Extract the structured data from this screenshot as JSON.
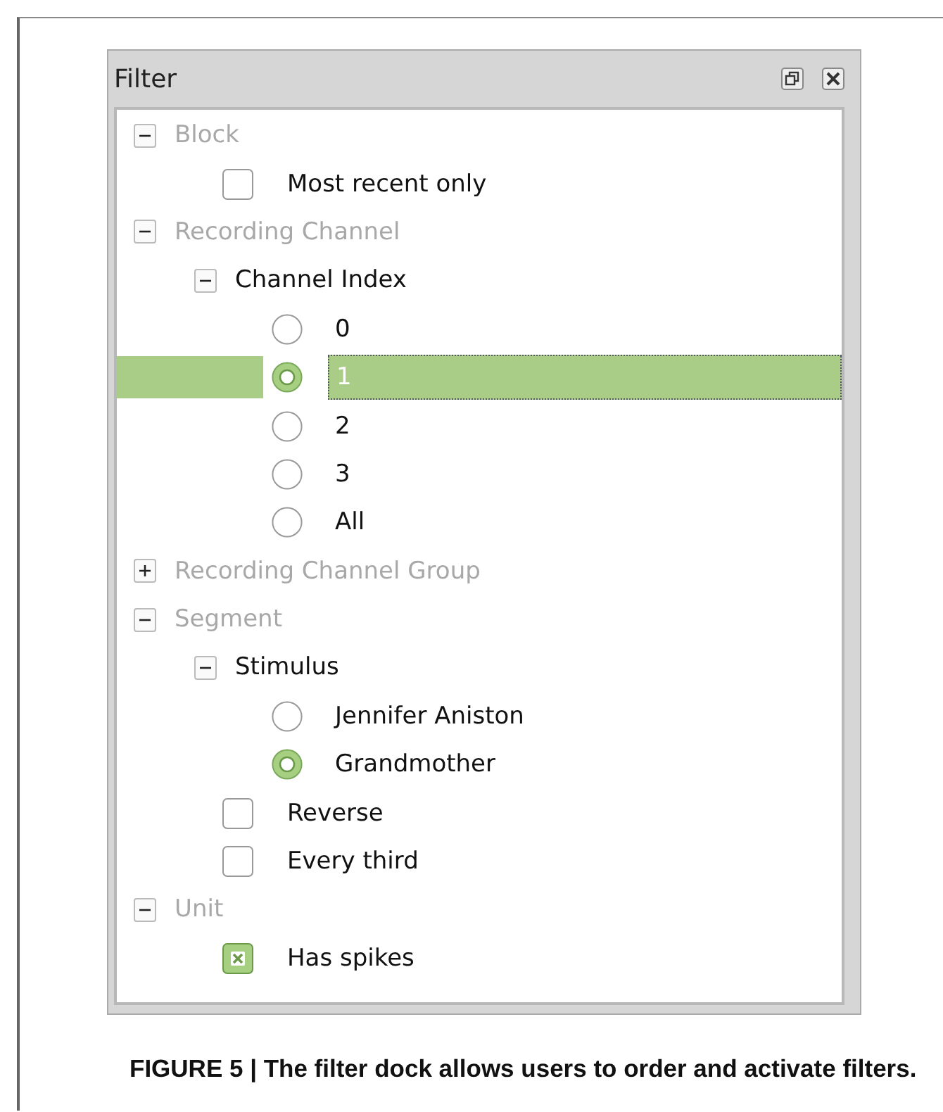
{
  "dock": {
    "title": "Filter"
  },
  "tree": [
    {
      "kind": "group",
      "label": "Block",
      "expanded": true,
      "children": [
        {
          "kind": "checkbox",
          "label": "Most recent only",
          "checked": false
        }
      ]
    },
    {
      "kind": "group",
      "label": "Recording Channel",
      "expanded": true,
      "children": [
        {
          "kind": "subgroup",
          "label": "Channel Index",
          "expanded": true,
          "children": [
            {
              "kind": "radio",
              "label": "0",
              "selected": false
            },
            {
              "kind": "radio",
              "label": "1",
              "selected": true,
              "current": true
            },
            {
              "kind": "radio",
              "label": "2",
              "selected": false
            },
            {
              "kind": "radio",
              "label": "3",
              "selected": false
            },
            {
              "kind": "radio",
              "label": "All",
              "selected": false
            }
          ]
        }
      ]
    },
    {
      "kind": "group",
      "label": "Recording Channel Group",
      "expanded": false
    },
    {
      "kind": "group",
      "label": "Segment",
      "expanded": true,
      "children": [
        {
          "kind": "subgroup",
          "label": "Stimulus",
          "expanded": true,
          "children": [
            {
              "kind": "radio",
              "label": "Jennifer Aniston",
              "selected": false
            },
            {
              "kind": "radio",
              "label": "Grandmother",
              "selected": true
            }
          ]
        },
        {
          "kind": "checkbox",
          "label": "Reverse",
          "checked": false
        },
        {
          "kind": "checkbox",
          "label": "Every third",
          "checked": false
        }
      ]
    },
    {
      "kind": "group",
      "label": "Unit",
      "expanded": true,
      "children": [
        {
          "kind": "checkbox",
          "label": "Has spikes",
          "checked": true
        }
      ]
    }
  ],
  "caption": "FIGURE 5 | The filter dock allows users to order and activate filters."
}
